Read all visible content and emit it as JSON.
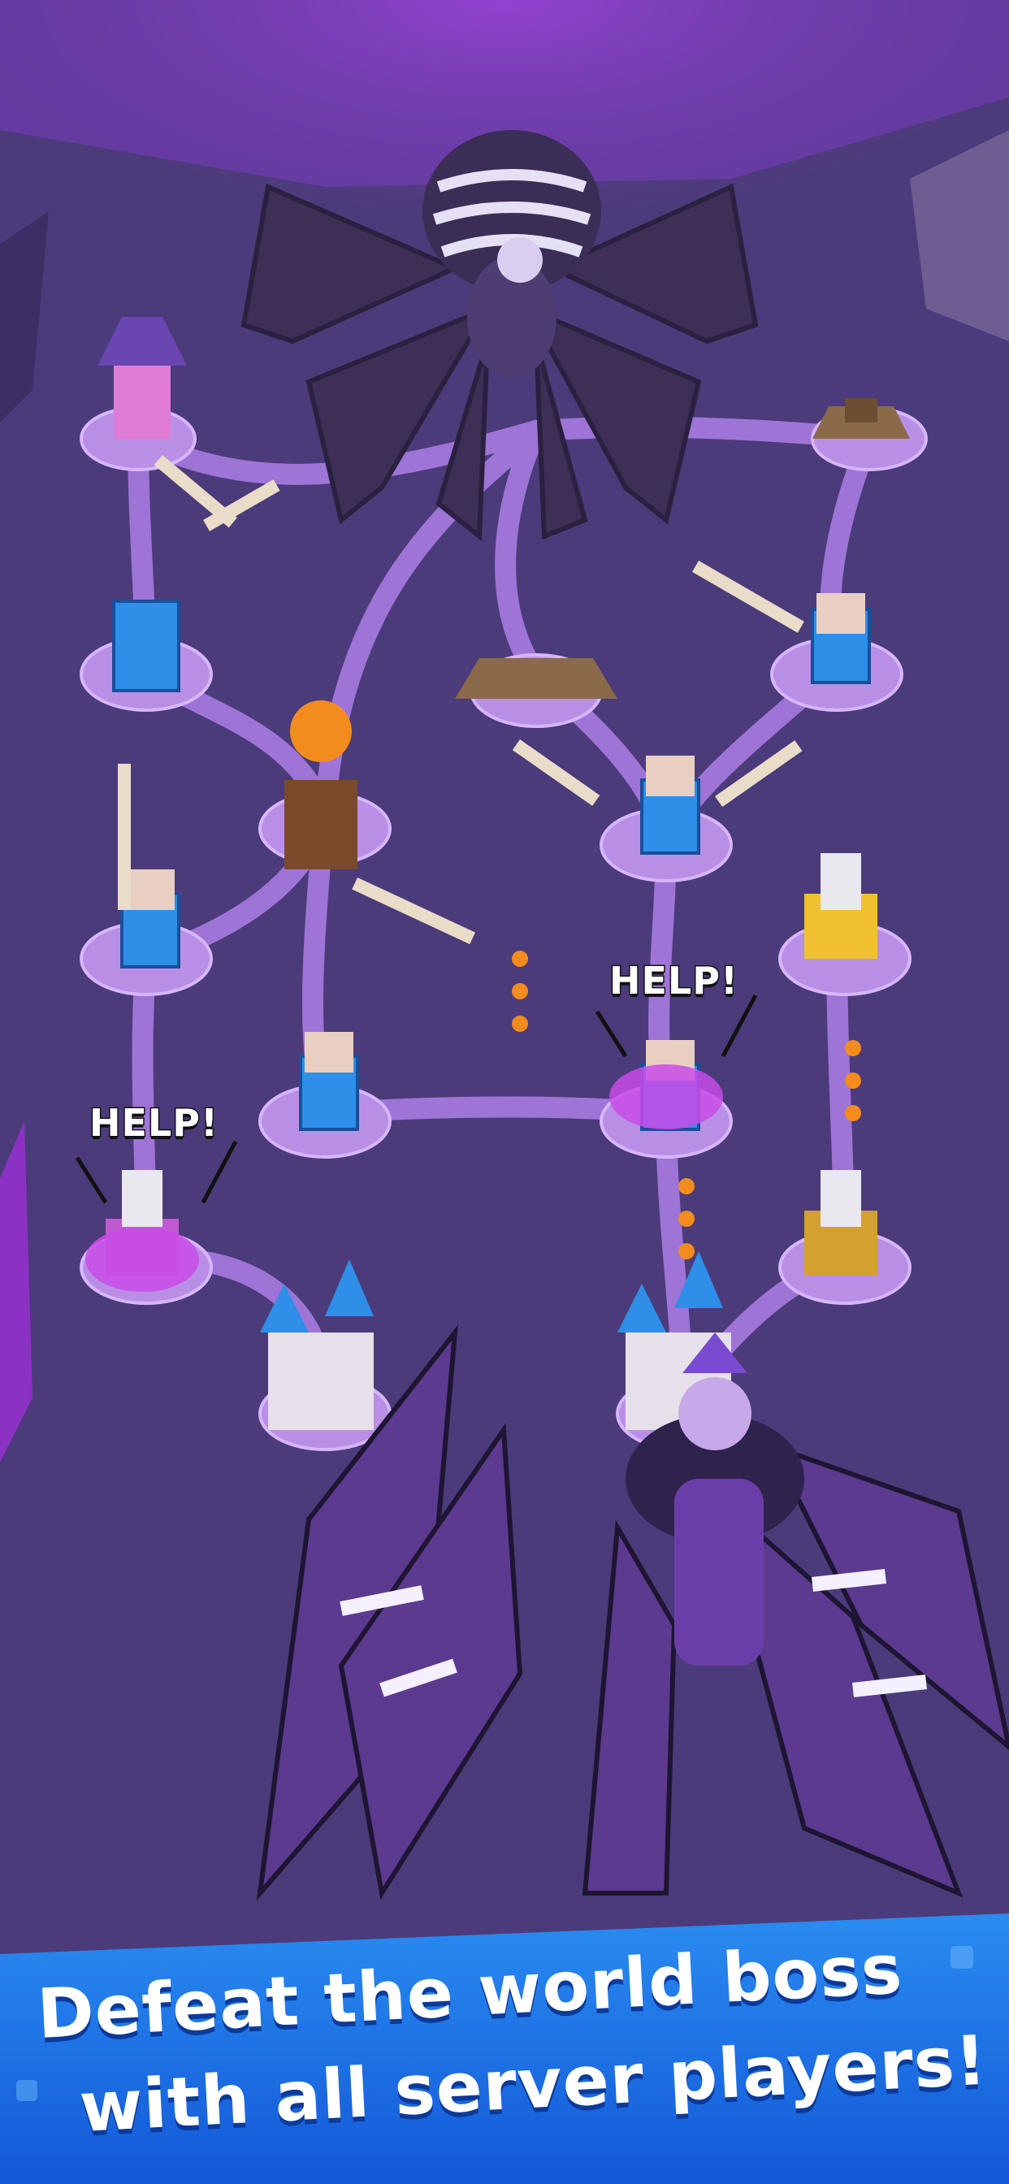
{
  "bubbles": {
    "help_left": "HELP!",
    "help_right": "HELP!"
  },
  "banner": {
    "line1": "Defeat the world boss",
    "line2": "with all server players!"
  },
  "colors": {
    "background": "#4a3a78",
    "path_glow": "#a77be0",
    "banner_blue": "#1976e6",
    "banner_dark": "#0b4fbf"
  }
}
